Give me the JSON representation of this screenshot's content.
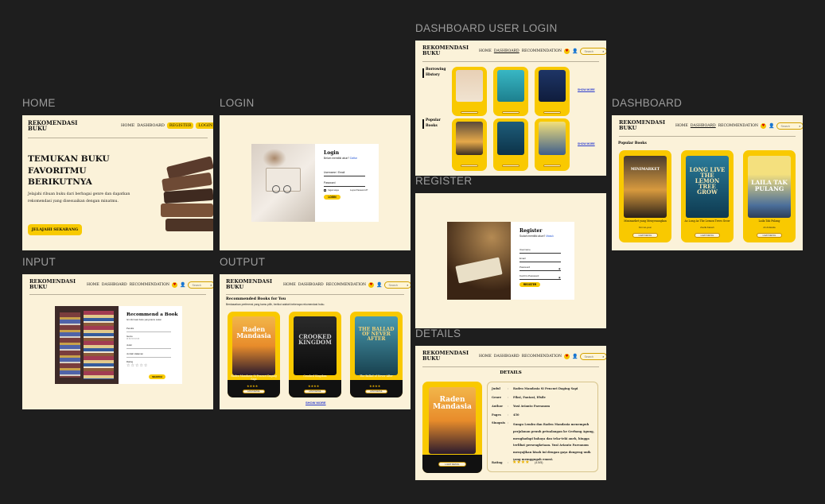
{
  "labels": {
    "home": "HOME",
    "login": "LOGIN",
    "input": "INPUT",
    "output": "OUTPUT",
    "dashboard_user_login": "DASHBOARD USER LOGIN",
    "register": "REGISTER",
    "details": "DETAILS",
    "dashboard": "DASHBOARD"
  },
  "brand": "REKOMENDASI BUKU",
  "nav": {
    "home": "HOME",
    "dashboard": "DASHBOARD",
    "recommendation": "RECOMMENDATION",
    "register": "REGISTER",
    "login": "LOGIN",
    "search_placeholder": "Search"
  },
  "home": {
    "headline": "TEMUKAN BUKU FAVORITMU BERIKUTNYA",
    "subtext": "Jelajahi ribuan buku dari berbagai genre dan dapatkan rekomendasi yang disesuaikan dengan minatmu.",
    "cta": "JELAJAHI SEKARANG"
  },
  "login": {
    "title": "Login",
    "subtitle": "Belum memiliki akun?",
    "subtitle_link": "Daftar",
    "username_label": "Username / Email",
    "password_label": "Password",
    "remember": "Ingat saya",
    "forgot": "Lupa Password?",
    "button": "LOGIN"
  },
  "register": {
    "title": "Register",
    "subtitle": "Sudah memiliki akun?",
    "subtitle_link": "Masuk",
    "fields": [
      "Username",
      "Email",
      "Password",
      "Konfirm Password"
    ],
    "button": "REGISTER"
  },
  "input": {
    "title": "Recommend a Book",
    "subtitle": "Isi informasi buku yang kamu sukai",
    "fields": [
      "Penulis",
      "Genre",
      "Judul",
      "Jumlah Halaman",
      "Rating"
    ]
  },
  "output": {
    "heading": "Recommended Books for You",
    "subheading": "Berdasarkan preferensi yang kamu pilih, berikut adalah beberapa rekomendasi buku.",
    "books": [
      {
        "cover_title": "Raden Mandasia",
        "title": "Raden Mandasia Si Pencuri Daging Sapi",
        "author": "Yusi Avianto Pareanom"
      },
      {
        "cover_title": "CROOKED KINGDOM",
        "title": "Crooked Kingdom",
        "author": "Leigh Bardugo"
      },
      {
        "cover_title": "THE BALLAD OF NEVER AFTER",
        "title": "The Ballad of Never After",
        "author": "Stephanie Garber"
      }
    ],
    "show_more": "SHOW MORE",
    "button": "LIHAT DETAIL"
  },
  "dashboard_user": {
    "section1": "Borrowing History",
    "section2": "Popular Books",
    "show_more": "SHOW MORE"
  },
  "dashboard": {
    "section": "Popular Books",
    "books": [
      {
        "cover_title": "MINIMARKET",
        "title": "Minimarket yang Menyenangkan",
        "author": "Kim Ho-yeon"
      },
      {
        "cover_title": "LONG LIVE THE LEMON TREE GROW",
        "title": "As Long As The Lemon Trees Grow",
        "author": "Zoulfa Katouh"
      },
      {
        "cover_title": "LAILA TAK PULANG",
        "title": "Laila Tak Pulang",
        "author": "Ari Ardianda"
      }
    ],
    "button": "LIHAT DETAIL"
  },
  "details": {
    "heading": "DETAILS",
    "cover_title": "Raden Mandasia",
    "button": "LIHAT DETAIL",
    "rows": [
      {
        "key": "Judul",
        "value": "Raden Mandasia Si Pencuri Daging Sapi"
      },
      {
        "key": "Genre",
        "value": "Fiksi, Fantasi, Efsile"
      },
      {
        "key": "Author",
        "value": "Yusi Avianto Pareanom"
      },
      {
        "key": "Pages",
        "value": "450"
      },
      {
        "key": "Sinopsis",
        "value": "Sungu Lembu dan Raden Mandasia menempuh perjalanan penuh petualangan ke Gerbang Agung, menghadapi bahaya dan teka-teki aneh, hingga terlibat persengketaan. Yusi Avianto Pareanom menyajikan kisah ini dengan gaya dongeng unik yang memggugah emosi."
      },
      {
        "key": "Rating",
        "value": "(4.5/5)"
      }
    ]
  }
}
